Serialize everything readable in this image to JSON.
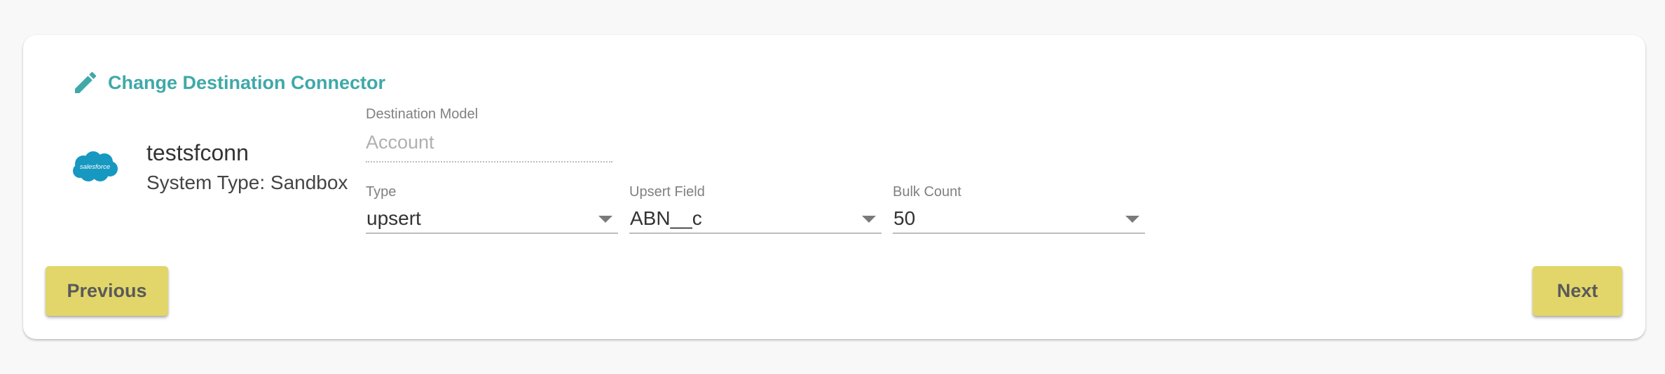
{
  "header": {
    "change_label": "Change Destination Connector",
    "icon": "pencil-icon",
    "accent_color": "#3fa9a8"
  },
  "connector": {
    "logo_text": "salesforce",
    "logo_color": "#1798c1",
    "name": "testsfconn",
    "system_type": "System Type: Sandbox"
  },
  "form": {
    "destination_model": {
      "label": "Destination Model",
      "value": "Account"
    },
    "type": {
      "label": "Type",
      "value": "upsert"
    },
    "upsert_field": {
      "label": "Upsert Field",
      "value": "ABN__c"
    },
    "bulk_count": {
      "label": "Bulk Count",
      "value": "50"
    }
  },
  "buttons": {
    "previous": "Previous",
    "next": "Next",
    "color": "#e2d66a"
  }
}
